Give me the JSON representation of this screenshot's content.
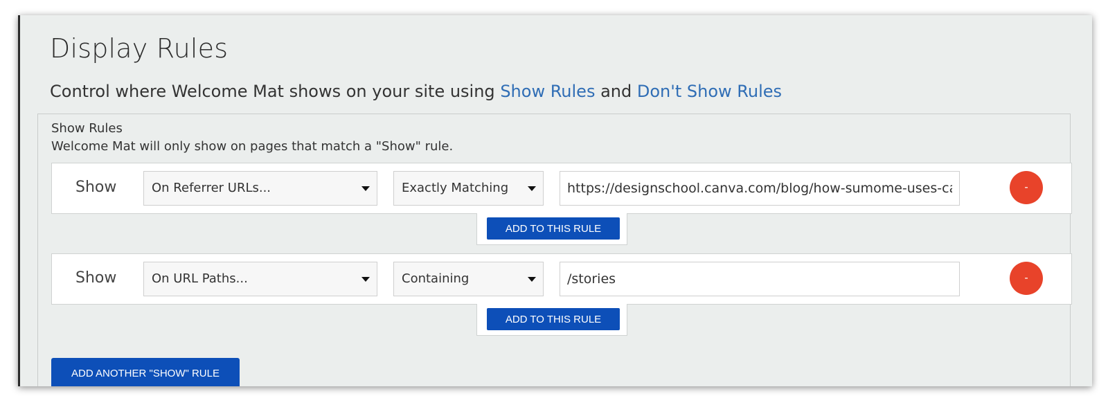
{
  "header": {
    "title": "Display Rules",
    "subtitle_text": "Control where Welcome Mat shows on your site using",
    "show_rules_link": "Show Rules",
    "and_text": "and",
    "dont_show_rules_link": "Don't Show Rules"
  },
  "show_rules": {
    "title": "Show Rules",
    "description": "Welcome Mat will only show on pages that match a \"Show\" rule.",
    "rules": [
      {
        "label": "Show",
        "target": "On Referrer URLs...",
        "condition": "Exactly Matching",
        "value": "https://designschool.canva.com/blog/how-sumome-uses-canva",
        "remove_label": "-",
        "add_label": "ADD TO THIS RULE"
      },
      {
        "label": "Show",
        "target": "On URL Paths...",
        "condition": "Containing",
        "value": "/stories",
        "remove_label": "-",
        "add_label": "ADD TO THIS RULE"
      }
    ],
    "add_another_label": "ADD ANOTHER \"SHOW\" RULE"
  },
  "colors": {
    "accent": "#0d4fb8",
    "link": "#2f6db5",
    "remove": "#e8432a",
    "background": "#ebeeed"
  }
}
